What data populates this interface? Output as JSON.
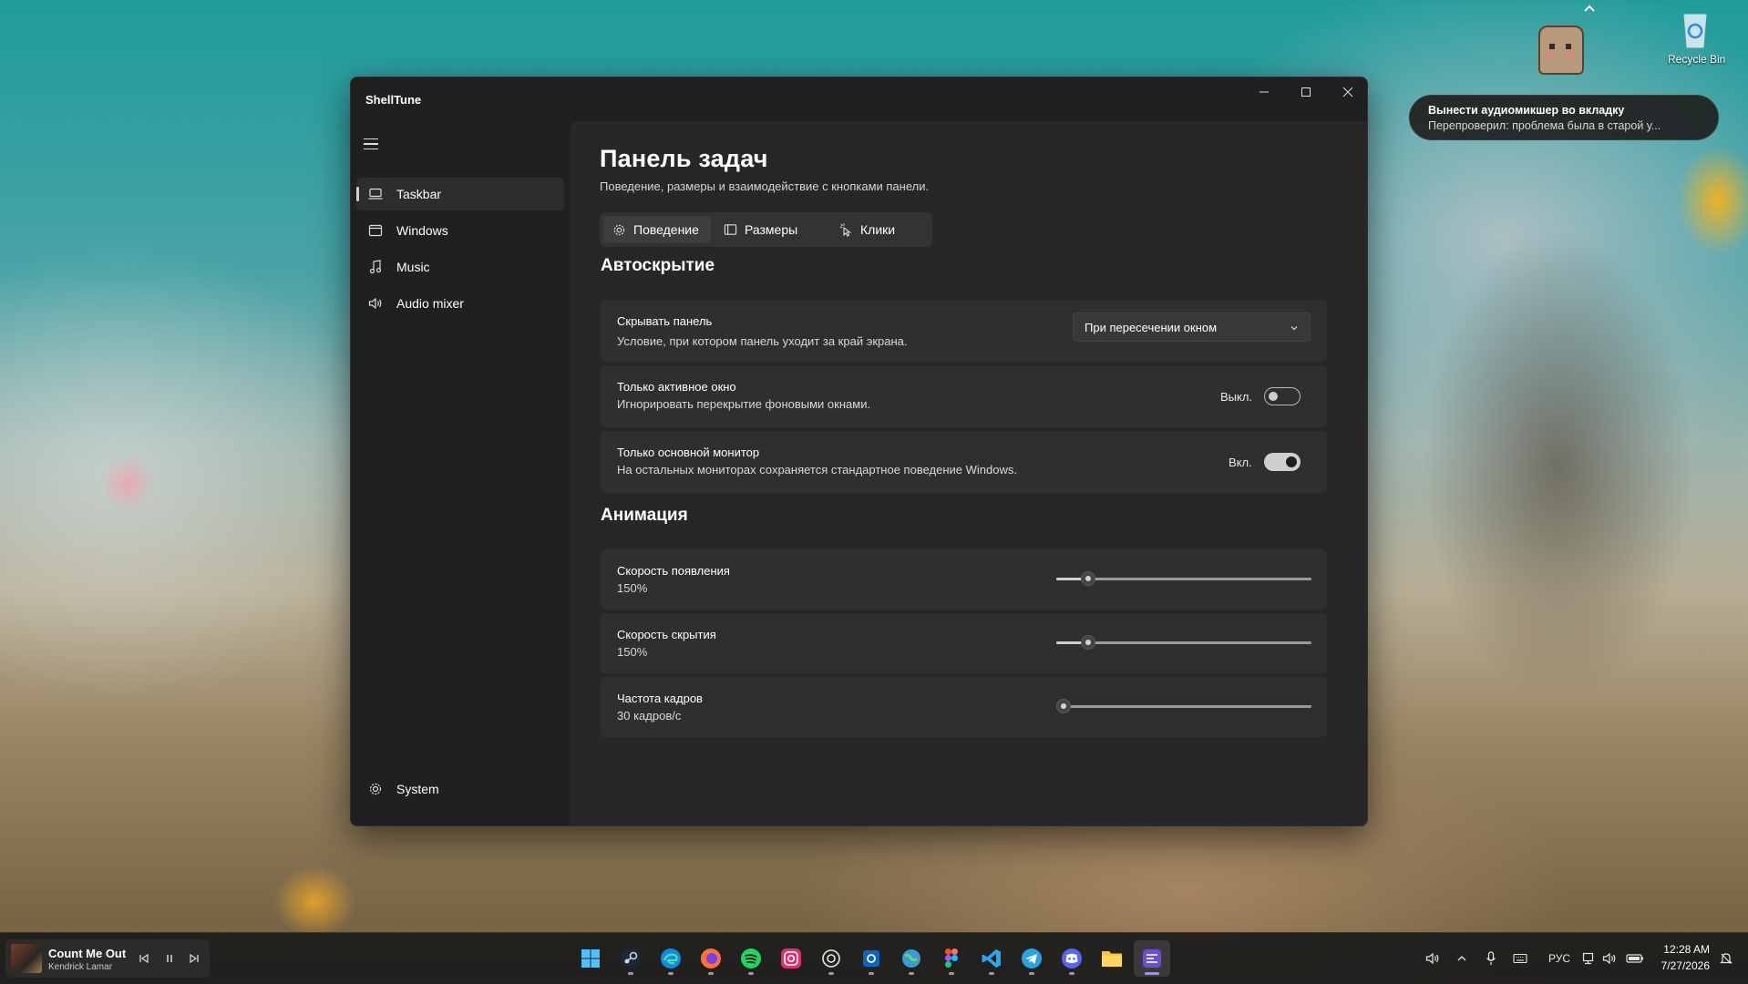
{
  "window": {
    "title": "ShellTune"
  },
  "sidebar": {
    "items": [
      {
        "label": "Taskbar",
        "icon": "laptop-icon"
      },
      {
        "label": "Windows",
        "icon": "window-icon"
      },
      {
        "label": "Music",
        "icon": "music-note-icon"
      },
      {
        "label": "Audio mixer",
        "icon": "speaker-icon"
      }
    ],
    "footer_label": "System"
  },
  "page": {
    "title": "Панель задач",
    "subtitle": "Поведение, размеры и взаимодействие с кнопками панели.",
    "tabs": [
      {
        "label": "Поведение",
        "icon": "gear-icon"
      },
      {
        "label": "Размеры",
        "icon": "layout-icon"
      },
      {
        "label": "Клики",
        "icon": "click-icon"
      }
    ]
  },
  "autohide": {
    "section_title": "Автоскрытие",
    "hide_panel": {
      "title": "Скрывать панель",
      "desc": "Условие, при котором панель уходит за край экрана.",
      "selected": "При пересечении окном"
    },
    "active_window_only": {
      "title": "Только активное окно",
      "desc": "Игнорировать перекрытие фоновыми окнами.",
      "state_label": "Выкл.",
      "on": false
    },
    "main_monitor_only": {
      "title": "Только основной монитор",
      "desc": "На остальных мониторах сохраняется стандартное поведение Windows.",
      "state_label": "Вкл.",
      "on": true
    }
  },
  "animation": {
    "section_title": "Анимация",
    "sliders": [
      {
        "title": "Скорость появления",
        "value_label": "150%",
        "fraction": 0.125
      },
      {
        "title": "Скорость скрытия",
        "value_label": "150%",
        "fraction": 0.125
      },
      {
        "title": "Частота кадров",
        "value_label": "30 кадров/с",
        "fraction": 0.03
      }
    ]
  },
  "notification": {
    "title": "Вынести аудиомикшер во вкладку",
    "text": "Перепроверил: проблема была в старой у..."
  },
  "desktop": {
    "recycle_bin_label": "Recycle Bin"
  },
  "media": {
    "title": "Count Me Out",
    "artist": "Kendrick Lamar"
  },
  "taskbar_apps": [
    "start-icon",
    "steam-icon",
    "edge-icon",
    "firefox-icon",
    "spotify-icon",
    "instagram-icon",
    "chatgpt-icon",
    "outlook-icon",
    "globe-icon",
    "figma-icon",
    "vscode-icon",
    "telegram-icon",
    "discord-icon",
    "file-explorer-icon",
    "shelltune-icon"
  ],
  "tray": {
    "language": "РУС",
    "time": "12:28 AM",
    "date": "7/27/2026"
  },
  "colors": {
    "accent": "#a78bfa",
    "window_bg": "#202020",
    "content_bg": "#272727",
    "card_bg": "#2f2f2f"
  }
}
